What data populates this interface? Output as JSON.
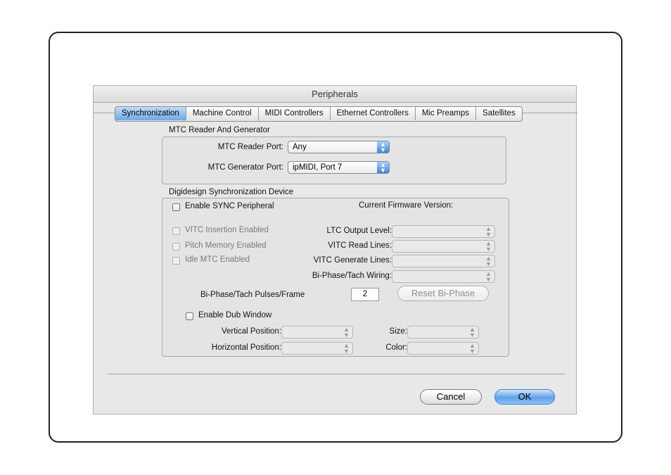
{
  "window": {
    "title": "Peripherals"
  },
  "tabs": [
    {
      "label": "Synchronization",
      "active": true
    },
    {
      "label": "Machine Control",
      "active": false
    },
    {
      "label": "MIDI Controllers",
      "active": false
    },
    {
      "label": "Ethernet Controllers",
      "active": false
    },
    {
      "label": "Mic Preamps",
      "active": false
    },
    {
      "label": "Satellites",
      "active": false
    }
  ],
  "mtc": {
    "group_label": "MTC Reader And Generator",
    "reader_port_label": "MTC Reader Port:",
    "reader_port_value": "Any",
    "generator_port_label": "MTC Generator Port:",
    "generator_port_value": "ipMIDI, Port 7"
  },
  "sync_device": {
    "group_label": "Digidesign Synchronization Device",
    "enable_sync_label": "Enable SYNC Peripheral",
    "enable_sync_checked": false,
    "firmware_label": "Current Firmware Version:",
    "vitc_insertion_label": "VITC Insertion Enabled",
    "pitch_memory_label": "Pitch Memory Enabled",
    "idle_mtc_label": "Idle MTC Enabled",
    "ltc_output_label": "LTC Output Level:",
    "vitc_read_label": "VITC Read Lines:",
    "vitc_generate_label": "VITC Generate Lines:",
    "biphase_wiring_label": "Bi-Phase/Tach Wiring:",
    "biphase_pulses_label": "Bi-Phase/Tach Pulses/Frame",
    "biphase_pulses_value": "2",
    "reset_biphase_label": "Reset Bi-Phase",
    "enable_dub_label": "Enable Dub Window",
    "vertical_position_label": "Vertical Position:",
    "horizontal_position_label": "Horizontal Position:",
    "size_label": "Size:",
    "color_label": "Color:"
  },
  "footer": {
    "cancel_label": "Cancel",
    "ok_label": "OK"
  },
  "colors": {
    "accent_blue": "#5fa0e8",
    "window_bg": "#e8e8e8"
  }
}
